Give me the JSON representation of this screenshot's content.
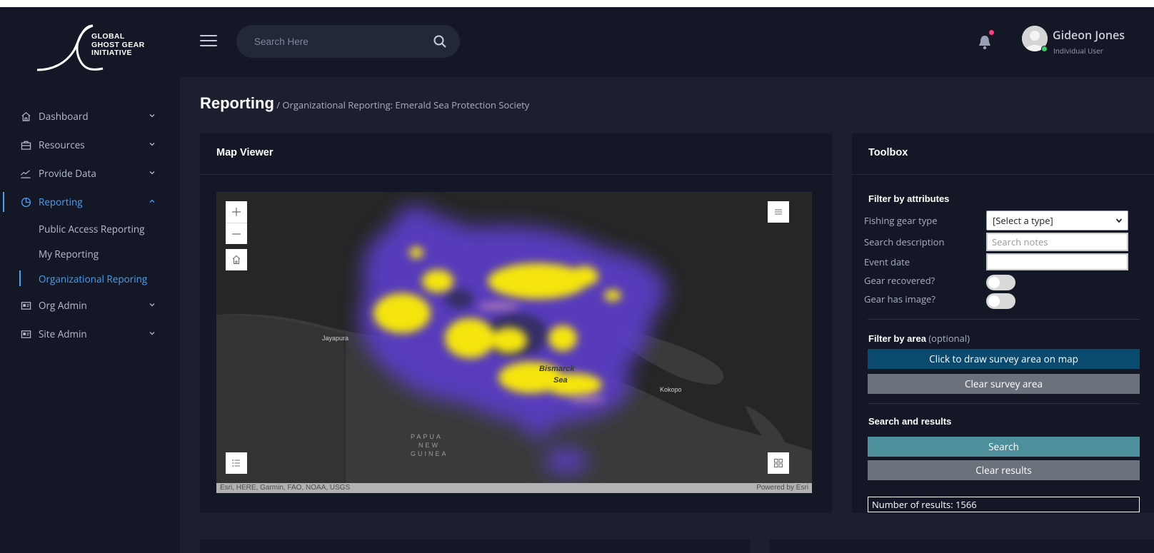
{
  "logo": {
    "line1": "GLOBAL",
    "line2": "GHOST GEAR",
    "line3": "INITIATIVE"
  },
  "sidebar": {
    "items": [
      {
        "label": "Dashboard",
        "icon": "home-icon"
      },
      {
        "label": "Resources",
        "icon": "briefcase-icon"
      },
      {
        "label": "Provide Data",
        "icon": "trend-chart-icon"
      },
      {
        "label": "Reporting",
        "icon": "pie-chart-icon"
      },
      {
        "label": "Org Admin",
        "icon": "id-card-icon"
      },
      {
        "label": "Site Admin",
        "icon": "id-card-icon"
      }
    ],
    "sub_items": [
      {
        "label": "Public Access Reporting"
      },
      {
        "label": "My Reporting"
      },
      {
        "label": "Organizational Reporing"
      }
    ]
  },
  "header": {
    "search_placeholder": "Search Here",
    "user_name": "Gideon Jones",
    "user_role": "Individual User"
  },
  "page": {
    "title": "Reporting",
    "breadcrumb": " / Organizational Reporting: Emerald Sea Protection Society"
  },
  "map_viewer": {
    "title": "Map Viewer",
    "labels": {
      "jayapura": "Jayapura",
      "kokopo": "Kokopo",
      "sea1": "Bismarck",
      "sea2": "Sea",
      "png1": "PAPUA",
      "png2": "NEW",
      "png3": "GUINEA"
    },
    "attribution": "Esri, HERE, Garmin, FAO, NOAA, USGS",
    "powered_by": "Powered by Esri"
  },
  "toolbox": {
    "title": "Toolbox",
    "filter_attributes": "Filter by attributes",
    "fishing_gear_label": "Fishing gear type",
    "fishing_gear_value": "[Select a type]",
    "search_description_label": "Search description",
    "search_notes_placeholder": "Search notes",
    "event_date_label": "Event date",
    "gear_recovered_label": "Gear recovered?",
    "gear_image_label": "Gear has image?",
    "filter_area": "Filter by area",
    "filter_area_optional": " (optional)",
    "draw_area_button": "Click to draw survey area on map",
    "clear_area_button": "Clear survey area",
    "search_results": "Search and results",
    "search_button": "Search",
    "clear_results_button": "Clear results",
    "results_text": "Number of results: 1566"
  },
  "colors": {
    "accent": "#4a9ff5",
    "draw_button": "#0b4a6f",
    "search_button": "#4d8f9a",
    "clear_button": "#6c727c",
    "heat_high": "#f5e50f",
    "heat_mid": "#5e3fc7"
  }
}
